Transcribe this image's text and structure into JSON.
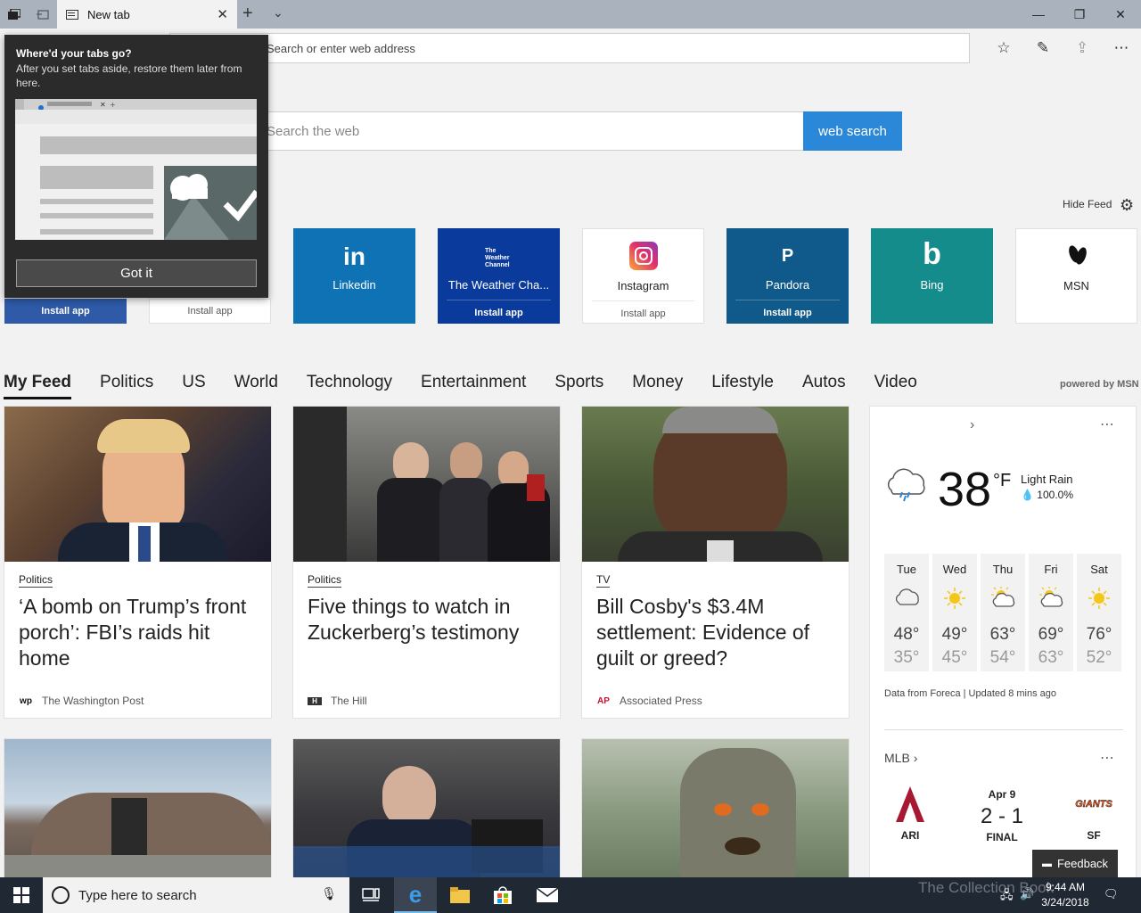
{
  "tab": {
    "title": "New tab"
  },
  "address": {
    "placeholder": "Search or enter web address"
  },
  "search": {
    "placeholder": "Search the web",
    "button": "web search"
  },
  "hide_feed": "Hide Feed",
  "popup": {
    "title": "Where'd your tabs go?",
    "body": "After you set tabs aside, restore them later from here.",
    "button": "Got it"
  },
  "tiles": [
    {
      "name": "Linkedin",
      "logo": "in",
      "color": "#0e72b5"
    },
    {
      "name": "The Weather Cha...",
      "logo": "The Weather Channel",
      "install": "Install app",
      "color": "#0a3a9c"
    },
    {
      "name": "Instagram",
      "logo": "instagram-icon",
      "install": "Install app",
      "color": "#ffffff"
    },
    {
      "name": "Pandora",
      "logo": "P",
      "install": "Install app",
      "color": "#0f5a8a"
    },
    {
      "name": "Bing",
      "logo": "b",
      "color": "#148c8c"
    },
    {
      "name": "MSN",
      "logo": "msn-butterfly",
      "color": "#ffffff"
    }
  ],
  "partial_tiles": [
    {
      "install": "Install app",
      "color": "#2e5aa8"
    },
    {
      "install": "Install app",
      "color": "#ffffff"
    }
  ],
  "feed_nav": [
    "My Feed",
    "Politics",
    "US",
    "World",
    "Technology",
    "Entertainment",
    "Sports",
    "Money",
    "Lifestyle",
    "Autos",
    "Video"
  ],
  "powered_by": "powered by MSN",
  "cards": [
    {
      "category": "Politics",
      "headline": "‘A bomb on Trump’s front porch’: FBI’s raids hit home",
      "source": "The Washington Post",
      "source_logo": "wp"
    },
    {
      "category": "Politics",
      "headline": "Five things to watch in Zuckerberg’s testimony",
      "source": "The Hill",
      "source_logo": "H"
    },
    {
      "category": "TV",
      "headline": "Bill Cosby's $3.4M settlement: Evidence of guilt or greed?",
      "source": "Associated Press",
      "source_logo": "AP"
    }
  ],
  "weather": {
    "temp": "38",
    "unit": "°F",
    "condition": "Light Rain",
    "precip": "100.0%",
    "forecast": [
      {
        "day": "Tue",
        "hi": "48°",
        "lo": "35°",
        "icon": "cloud"
      },
      {
        "day": "Wed",
        "hi": "49°",
        "lo": "45°",
        "icon": "sun"
      },
      {
        "day": "Thu",
        "hi": "63°",
        "lo": "54°",
        "icon": "partly-sunny"
      },
      {
        "day": "Fri",
        "hi": "69°",
        "lo": "63°",
        "icon": "partly-sunny"
      },
      {
        "day": "Sat",
        "hi": "76°",
        "lo": "52°",
        "icon": "sun"
      }
    ],
    "source": "Data from Foreca | Updated 8 mins ago"
  },
  "mlb": {
    "title": "MLB",
    "date": "Apr 9",
    "score": "2 - 1",
    "status": "FINAL",
    "away": "ARI",
    "home": "SF",
    "home_logo": "GIANTS"
  },
  "feedback": "Feedback",
  "taskbar": {
    "search_placeholder": "Type here to search",
    "time": "9:44 AM",
    "date": "3/24/2018"
  },
  "watermark": "The Collection Book"
}
